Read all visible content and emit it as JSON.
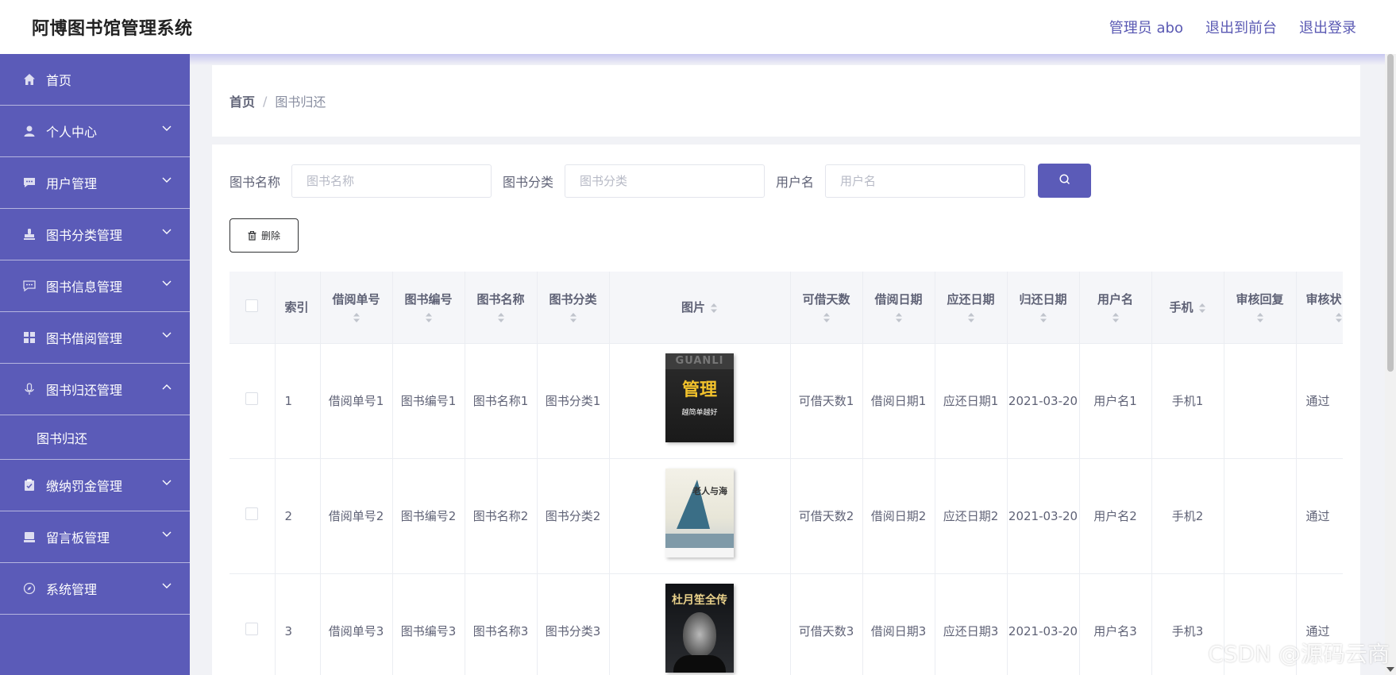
{
  "app": {
    "title": "阿博图书馆管理系统",
    "nav": {
      "admin_label": "管理员 abo",
      "to_frontend": "退出到前台",
      "logout": "退出登录"
    }
  },
  "sidebar": {
    "items": [
      {
        "label": "首页",
        "icon": "home-icon",
        "expandable": false
      },
      {
        "label": "个人中心",
        "icon": "user-icon",
        "expandable": true
      },
      {
        "label": "用户管理",
        "icon": "chat-bubble-icon",
        "expandable": true
      },
      {
        "label": "图书分类管理",
        "icon": "stamp-icon",
        "expandable": true
      },
      {
        "label": "图书信息管理",
        "icon": "message-icon",
        "expandable": true
      },
      {
        "label": "图书借阅管理",
        "icon": "grid-icon",
        "expandable": true
      },
      {
        "label": "图书归还管理",
        "icon": "microphone-icon",
        "expandable": true,
        "expanded": true,
        "children": [
          "图书归还"
        ]
      },
      {
        "label": "缴纳罚金管理",
        "icon": "clipboard-icon",
        "expandable": true
      },
      {
        "label": "留言板管理",
        "icon": "monitor-icon",
        "expandable": true
      },
      {
        "label": "系统管理",
        "icon": "compass-icon",
        "expandable": true
      }
    ]
  },
  "breadcrumb": {
    "home": "首页",
    "separator": "/",
    "current": "图书归还"
  },
  "search": {
    "book_name_label": "图书名称",
    "book_name_placeholder": "图书名称",
    "category_label": "图书分类",
    "category_placeholder": "图书分类",
    "username_label": "用户名",
    "username_placeholder": "用户名",
    "button_icon": "search-icon"
  },
  "toolbar": {
    "delete_label": "删除"
  },
  "table": {
    "columns": [
      "索引",
      "借阅单号",
      "图书编号",
      "图书名称",
      "图书分类",
      "图片",
      "可借天数",
      "借阅日期",
      "应还日期",
      "归还日期",
      "用户名",
      "手机",
      "审核回复",
      "审核状"
    ],
    "rows": [
      {
        "index": "1",
        "borrow_no": "借阅单号1",
        "book_no": "图书编号1",
        "book_name": "图书名称1",
        "category": "图书分类1",
        "cover": "管理越简单越好",
        "days": "可借天数1",
        "borrow_date": "借阅日期1",
        "due_date": "应还日期1",
        "return_date": "2021-03-20",
        "username": "用户名1",
        "phone": "手机1",
        "review_reply": "",
        "review_status": "通过"
      },
      {
        "index": "2",
        "borrow_no": "借阅单号2",
        "book_no": "图书编号2",
        "book_name": "图书名称2",
        "category": "图书分类2",
        "cover": "老人与海",
        "days": "可借天数2",
        "borrow_date": "借阅日期2",
        "due_date": "应还日期2",
        "return_date": "2021-03-20",
        "username": "用户名2",
        "phone": "手机2",
        "review_reply": "",
        "review_status": "通过"
      },
      {
        "index": "3",
        "borrow_no": "借阅单号3",
        "book_no": "图书编号3",
        "book_name": "图书名称3",
        "category": "图书分类3",
        "cover": "杜月笙全传",
        "days": "可借天数3",
        "borrow_date": "借阅日期3",
        "due_date": "应还日期3",
        "return_date": "2021-03-20",
        "username": "用户名3",
        "phone": "手机3",
        "review_reply": "",
        "review_status": "通过"
      }
    ]
  },
  "covers": {
    "c1_top": "GUANLI",
    "c1_main": "管理",
    "c1_sub": "越简单越好",
    "c2_title": "老人与海",
    "c3_title": "杜月笙全传"
  },
  "watermark": "CSDN @源码云商",
  "colors": {
    "accent": "#5b5bb8",
    "link": "#5a59b3",
    "header_bg": "#f5f6f9"
  }
}
